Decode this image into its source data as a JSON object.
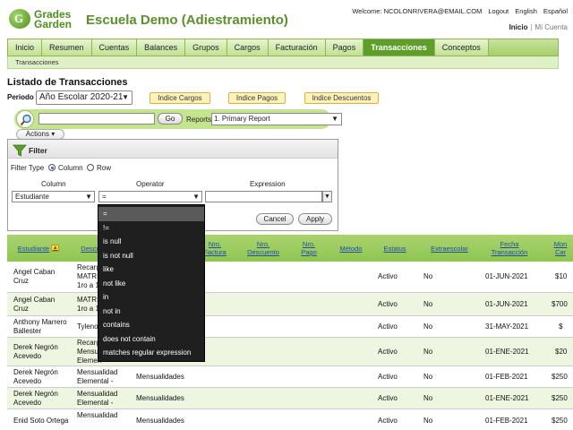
{
  "brand": {
    "logo_glyph": "G",
    "logo_word_1": "Grades",
    "logo_word_2": "Garden",
    "title": "Escuela Demo (Adiestramiento)"
  },
  "header": {
    "welcome": "Welcome: NCOLONRIVERA@EMAIL.COM",
    "logout": "Logout",
    "lang_en": "English",
    "lang_es": "Español",
    "inicio": "Inicio",
    "separator": "|",
    "mi_cuenta": "Mi Cuenta"
  },
  "nav": {
    "tabs": [
      "Inicio",
      "Resumen",
      "Cuentas",
      "Balances",
      "Grupos",
      "Cargos",
      "Facturación",
      "Pagos",
      "Transacciones",
      "Conceptos"
    ],
    "active": "Transacciones",
    "sub": "Transacciones"
  },
  "page": {
    "heading": "Listado de Transacciones",
    "periodo_label": "Periodo",
    "periodo_value": "Año Escolar 2020-21",
    "btn_cargos": "Indice Cargos",
    "btn_pagos": "Indice Pagos",
    "btn_descuentos": "Indice Descuentos"
  },
  "search": {
    "go": "Go",
    "reports_label": "Reports",
    "reports_value": "1. Primary Report",
    "actions": "Actions"
  },
  "filter": {
    "title": "Filter",
    "type_label": "Filter Type",
    "opt_column": "Column",
    "opt_row": "Row",
    "col_header": "Column",
    "op_header": "Operator",
    "expr_header": "Expression",
    "column_value": "Estudiante",
    "operator_value": "=",
    "cancel": "Cancel",
    "apply": "Apply"
  },
  "operator_options": [
    "=",
    "!=",
    "is null",
    "is not null",
    "like",
    "not like",
    "in",
    "not in",
    "contains",
    "does not contain",
    "matches regular expression"
  ],
  "table": {
    "headers": {
      "estudiante": "Estudiante",
      "descripcion": "Descrip",
      "concepto": "",
      "nro_factura": "Nro. Factura",
      "nro_descuento": "Nro. Descuento",
      "nro_pago": "Nro. Pago",
      "metodo": "Método",
      "estatus": "Estatus",
      "extraescolar": "Extraescolar",
      "fecha": "Fecha Transacción",
      "monto": "Mon Car"
    },
    "rows": [
      {
        "student": [
          "Angel Caban",
          "Cruz"
        ],
        "desc": [
          "Recarg",
          "MATRIC",
          "1ro a 1"
        ],
        "concept": "",
        "status": "Activo",
        "extra": "No",
        "date": "01-JUN-2021",
        "amount": "$10"
      },
      {
        "student": [
          "Angel Caban",
          "Cruz"
        ],
        "desc": [
          "MATRIC",
          "1ro a 1"
        ],
        "concept": "",
        "status": "Activo",
        "extra": "No",
        "date": "01-JUN-2021",
        "amount": "$700"
      },
      {
        "student": [
          "Anthony Marrero",
          "Ballester"
        ],
        "desc": [
          "Tyleno"
        ],
        "concept": "",
        "status": "Activo",
        "extra": "No",
        "date": "31-MAY-2021",
        "amount": "$"
      },
      {
        "student": [
          "Derek Negrón",
          "Acevedo"
        ],
        "desc": [
          "Recarg",
          "Mensua",
          "Elemen"
        ],
        "concept": "",
        "status": "Activo",
        "extra": "No",
        "date": "01-ENE-2021",
        "amount": "$20"
      },
      {
        "student": [
          "Derek Negrón",
          "Acevedo"
        ],
        "desc": [
          "Mensualidad",
          "Elemental -"
        ],
        "concept": "Mensualidades",
        "status": "Activo",
        "extra": "No",
        "date": "01-FEB-2021",
        "amount": "$250"
      },
      {
        "student": [
          "Derek Negrón",
          "Acevedo"
        ],
        "desc": [
          "Mensualidad",
          "Elemental -"
        ],
        "concept": "Mensualidades",
        "status": "Activo",
        "extra": "No",
        "date": "01-ENE-2021",
        "amount": "$250"
      },
      {
        "student": [
          "Enid Soto Ortega"
        ],
        "desc": [
          "Mensualidad"
        ],
        "concept": "Mensualidades",
        "status": "Activo",
        "extra": "No",
        "date": "01-FEB-2021",
        "amount": "$250"
      }
    ]
  }
}
